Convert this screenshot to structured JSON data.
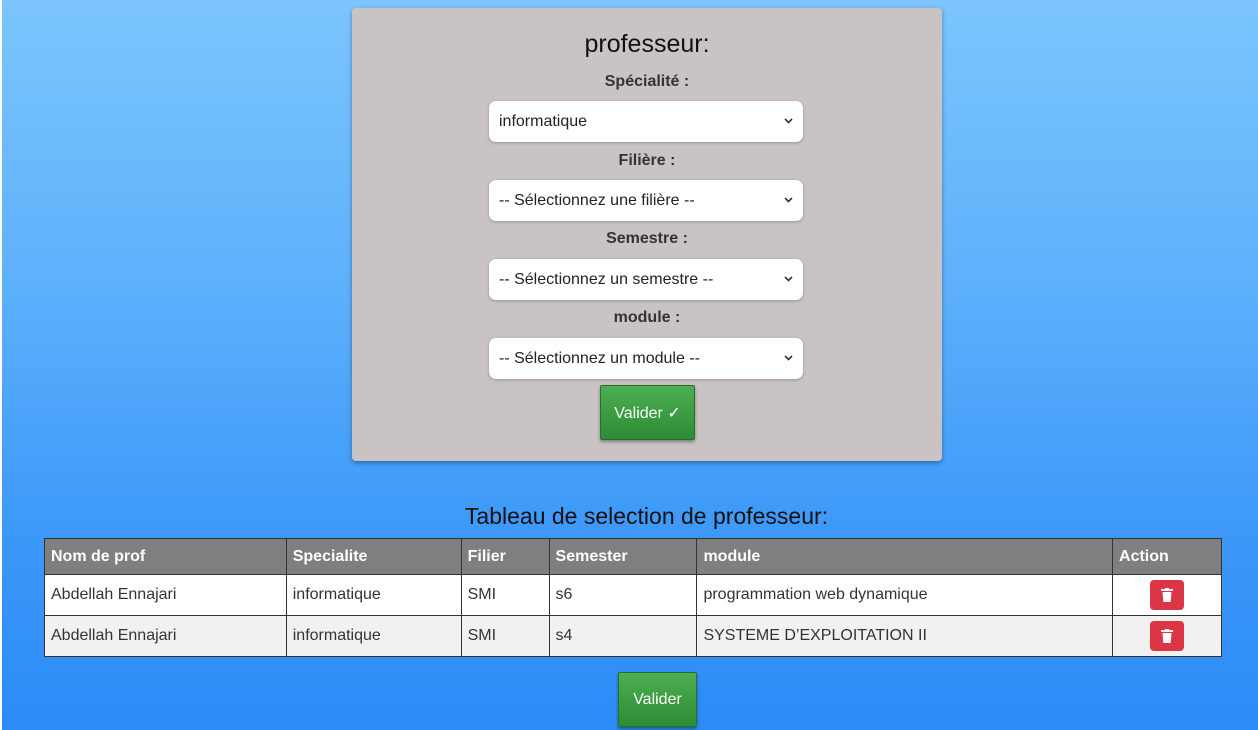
{
  "form": {
    "title": "professeur:",
    "specialite_label": "Spécialité :",
    "specialite_value": "informatique",
    "filiere_label": "Filière :",
    "filiere_value": "-- Sélectionnez une filière --",
    "semestre_label": "Semestre :",
    "semestre_value": "-- Sélectionnez un semestre --",
    "module_label": "module :",
    "module_value": "-- Sélectionnez un module --",
    "submit_label": "Valider ✓"
  },
  "table": {
    "title": "Tableau de selection de professeur:",
    "headers": [
      "Nom de prof",
      "Specialite",
      "Filier",
      "Semester",
      "module",
      "Action"
    ],
    "rows": [
      [
        "Abdellah Ennajari",
        "informatique",
        "SMI",
        "s6",
        "programmation web dynamique"
      ],
      [
        "Abdellah Ennajari",
        "informatique",
        "SMI",
        "s4",
        "SYSTEME D’EXPLOITATION II"
      ]
    ],
    "delete_icon": "trash-icon",
    "delete_color": "#dc3545"
  },
  "footer": {
    "validate_label": "Valider"
  },
  "colors": {
    "background_top": "#7cc5fd",
    "background_bottom": "#2b8cf7",
    "card": "#c9c3c3",
    "header": "#7f7f7f",
    "button": "#3a9b40"
  }
}
